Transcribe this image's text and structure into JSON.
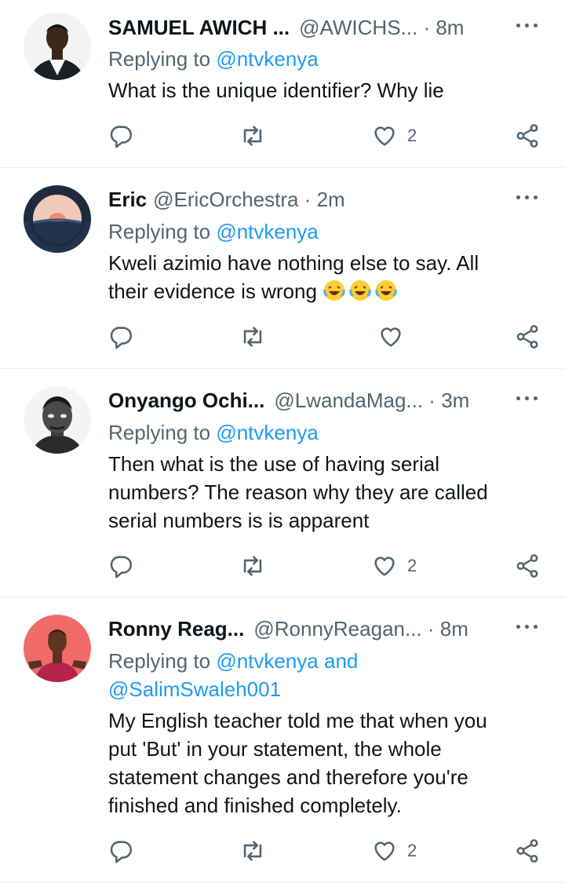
{
  "tweets": [
    {
      "name": "SAMUEL AWICH ...",
      "handle": "@AWICHS...",
      "dot": " · ",
      "time": "8m",
      "replying_prefix": "Replying to ",
      "replying_to": "@ntvkenya",
      "replying_to_line2": "",
      "text_lines": [
        "What is the unique identifier? Why lie"
      ],
      "likes": "2",
      "avatar": "person-white-shirt"
    },
    {
      "name": "Eric",
      "handle": "@EricOrchestra",
      "dot": " · ",
      "time": "2m",
      "replying_prefix": "Replying to ",
      "replying_to": "@ntvkenya",
      "replying_to_line2": "",
      "text_lines": [
        "Kweli azimio have nothing else to say. All",
        "their evidence is wrong"
      ],
      "emoji": "face-with-tears-of-joy ×3",
      "likes": "",
      "avatar": "sunset-over-sea"
    },
    {
      "name": "Onyango Ochi...",
      "handle": "@LwandaMag...",
      "dot": " · ",
      "time": "3m",
      "replying_prefix": "Replying to ",
      "replying_to": "@ntvkenya",
      "replying_to_line2": "",
      "text_lines": [
        "Then what is the use of having serial",
        "numbers? The reason why they are called",
        "serial numbers is is apparent"
      ],
      "likes": "2",
      "avatar": "portrait-bw"
    },
    {
      "name": "Ronny Reag...",
      "handle": "@RonnyReagan...",
      "dot": " · ",
      "time": "8m",
      "replying_prefix": "Replying to ",
      "replying_to": "@ntvkenya and",
      "replying_to_line2": "@SalimSwaleh001",
      "text_lines": [
        "My English teacher told me that when you",
        "put 'But' in your statement, the whole",
        "statement changes and therefore you're",
        "finished and finished completely."
      ],
      "likes": "2",
      "avatar": "person-red-background"
    }
  ],
  "icons": {
    "reply": "reply-icon",
    "retweet": "retweet-icon",
    "like": "heart-icon",
    "share": "share-icon",
    "more": "more-icon"
  },
  "colors": {
    "link": "#1d9bf0",
    "secondary_text": "#536471",
    "divider": "#e6ecf0"
  }
}
